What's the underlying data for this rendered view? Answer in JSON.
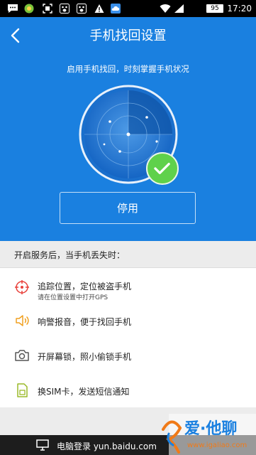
{
  "status_bar": {
    "battery": "95",
    "time": "17:20",
    "icons": [
      "message-icon",
      "app-icon",
      "screenshot-icon",
      "paw-icon",
      "paw-icon",
      "warning-icon",
      "weather-icon",
      "wifi-icon",
      "signal-icon"
    ]
  },
  "header": {
    "title": "手机找回设置",
    "subtitle": "启用手机找回，时刻掌握手机状况"
  },
  "status": {
    "enabled": true,
    "accent": "#1a80e0",
    "check_color": "#5fd14b"
  },
  "stop_button": {
    "label": "停用"
  },
  "section": {
    "header": "开启服务后，当手机丢失时："
  },
  "features": [
    {
      "icon": "locate-icon",
      "title": "追踪位置，定位被盗手机",
      "subtitle": "请在位置设置中打开GPS"
    },
    {
      "icon": "speaker-icon",
      "title": "响警报音，便于找回手机"
    },
    {
      "icon": "camera-icon",
      "title": "开屏幕锁，照小偷锁手机"
    },
    {
      "icon": "sim-icon",
      "title": "换SIM卡，发送短信通知"
    }
  ],
  "bottom_bar": {
    "text": "电脑登录 yun.baidu.com"
  },
  "watermark": {
    "text": "爱·他聊",
    "url": "www.igaliao.com"
  }
}
